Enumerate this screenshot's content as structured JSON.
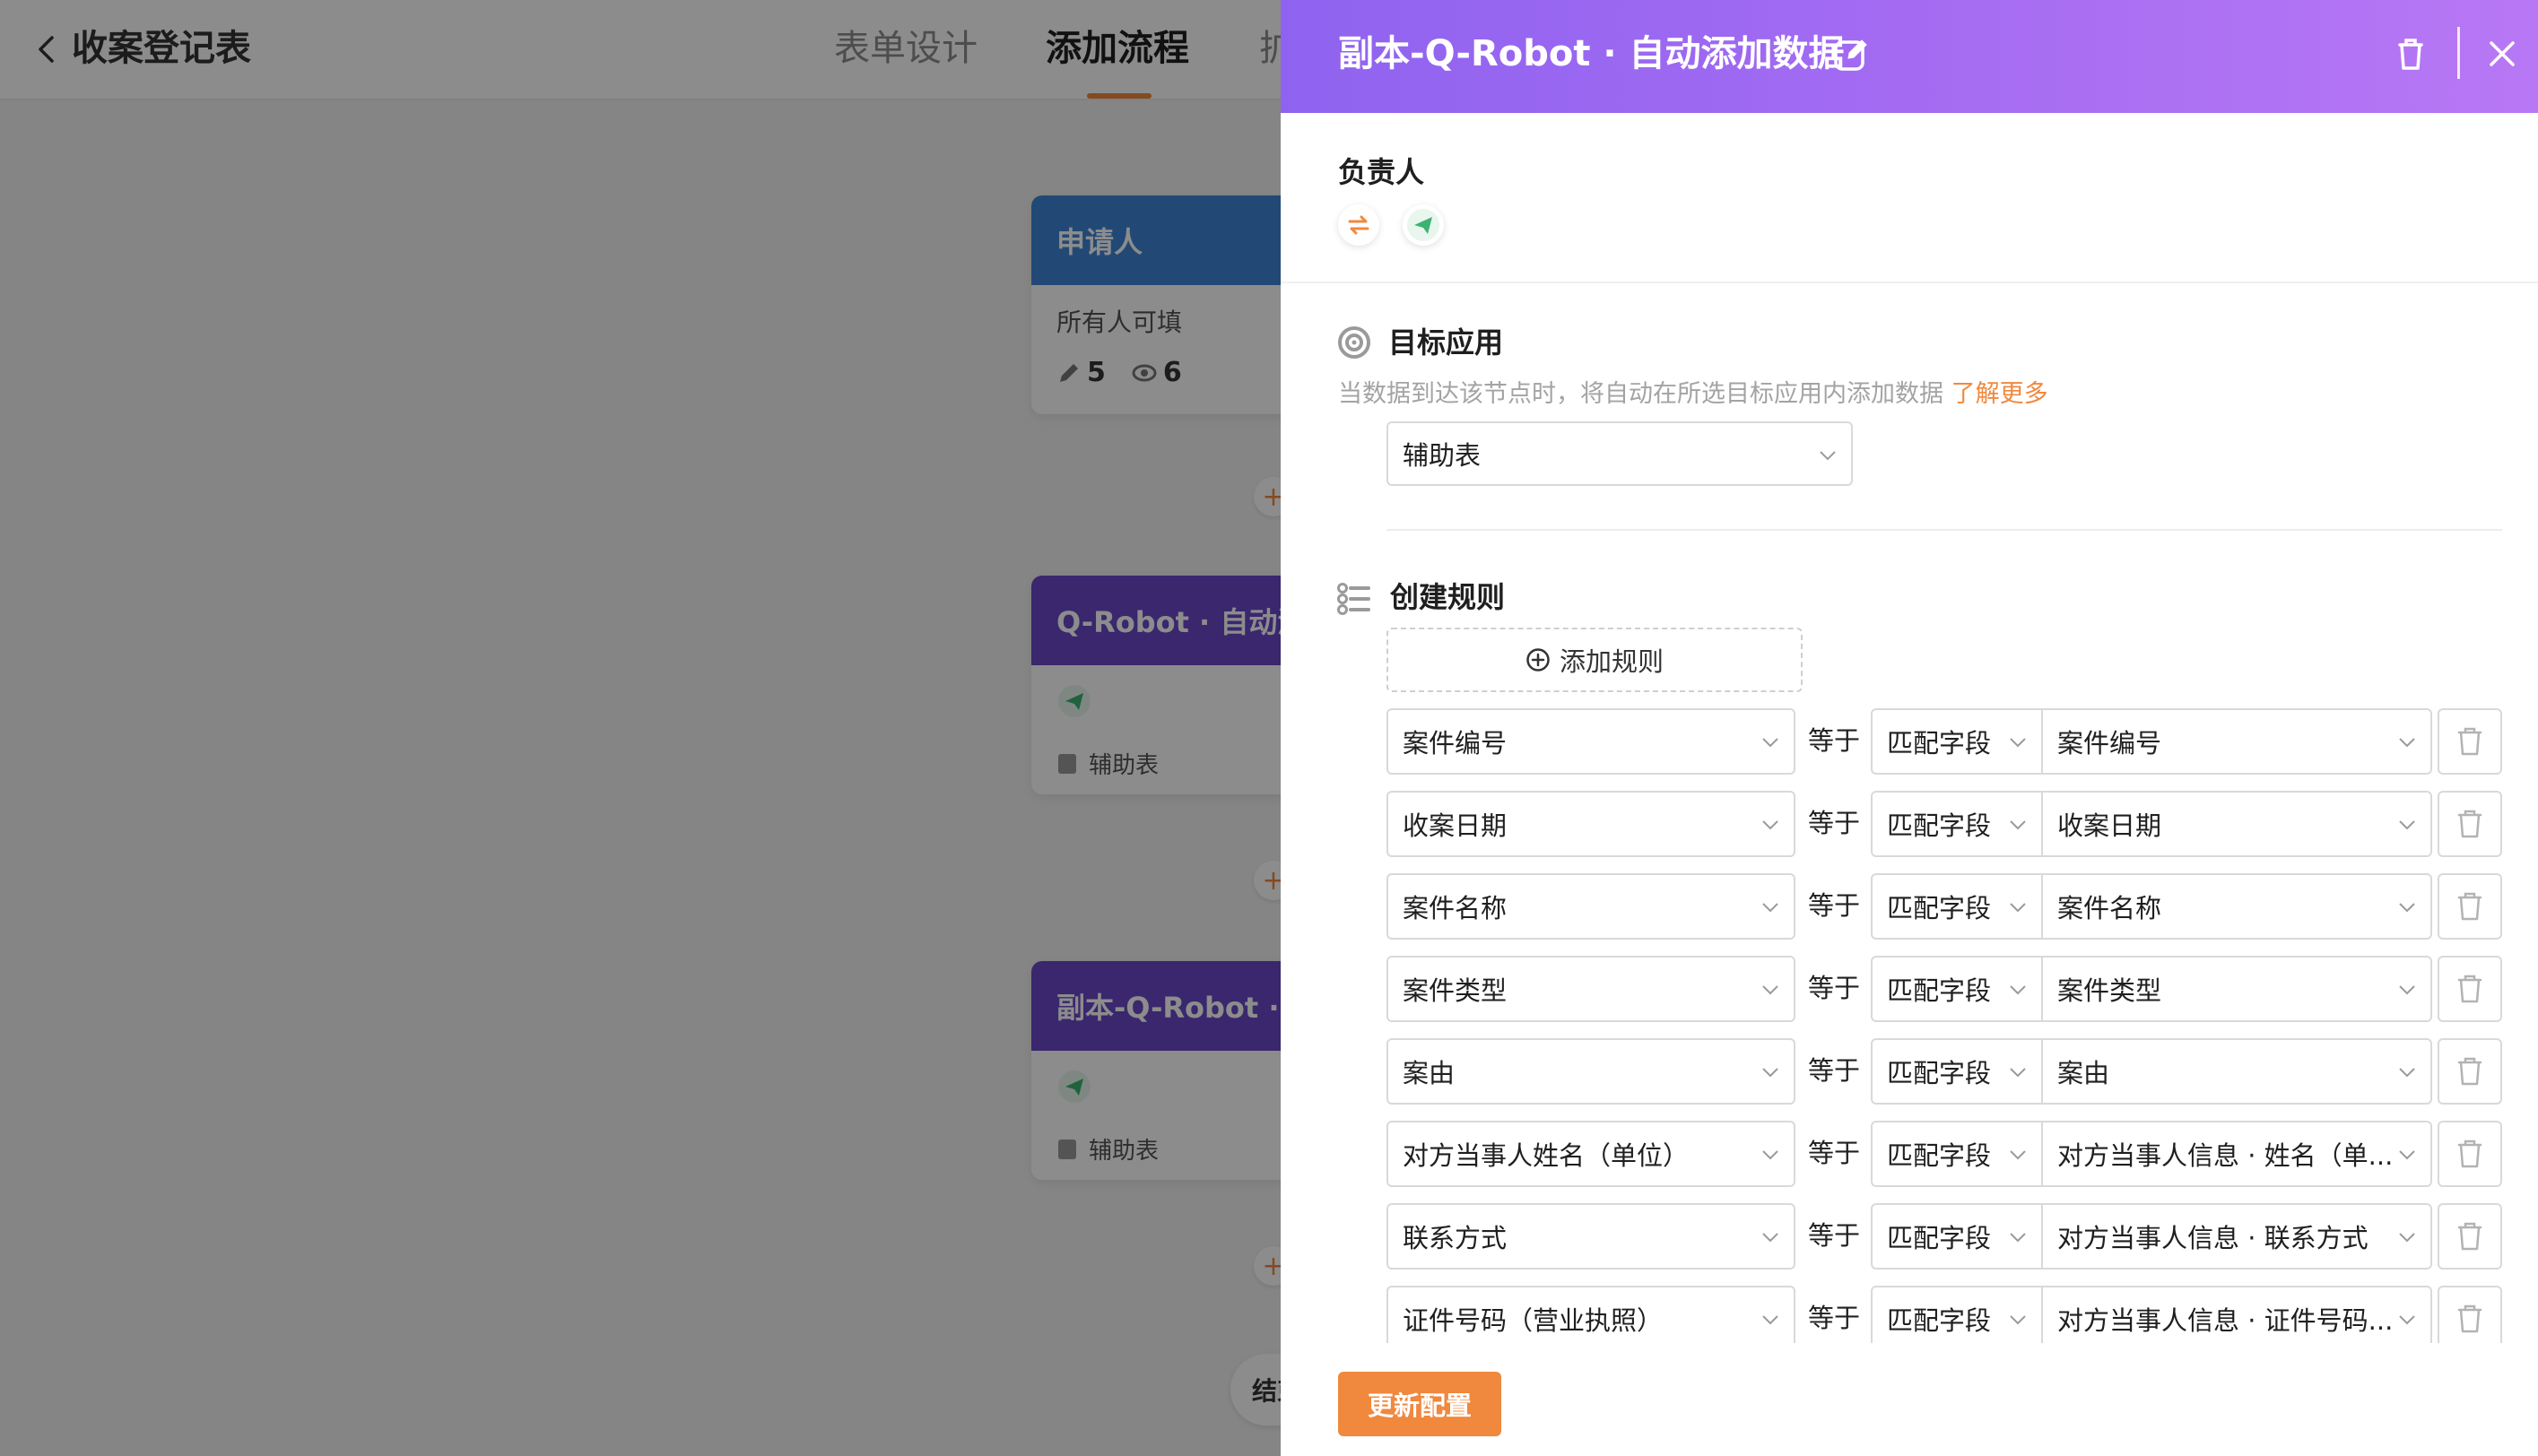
{
  "background": {
    "title": "收案登记表",
    "tabs": [
      {
        "label": "表单设计"
      },
      {
        "label": "添加流程"
      },
      {
        "label": "扩"
      }
    ],
    "nodes": [
      {
        "title": "申请人",
        "subtitle": "所有人可填",
        "edit_count": "5",
        "view_count": "6",
        "color": "#3f85d6"
      },
      {
        "title": "Q-Robot · 自动添",
        "target": "辅助表",
        "color": "#6a47c9"
      },
      {
        "title": "副本-Q-Robot · 自",
        "target": "辅助表",
        "color": "#6a47c9"
      }
    ],
    "end_label": "结束"
  },
  "drawer": {
    "title": "副本-Q-Robot · 自动添加数据",
    "owner": {
      "label": "负责人",
      "icons": [
        "swap-icon",
        "paper-plane-icon"
      ]
    },
    "target_app": {
      "title": "目标应用",
      "description": "当数据到达该节点时，将自动在所选目标应用内添加数据",
      "learn_more": "了解更多",
      "selected": "辅助表"
    },
    "rules": {
      "title": "创建规则",
      "add_label": "添加规则",
      "operator": "等于",
      "items": [
        {
          "field": "案件编号",
          "mode": "匹配字段",
          "value": "案件编号"
        },
        {
          "field": "收案日期",
          "mode": "匹配字段",
          "value": "收案日期"
        },
        {
          "field": "案件名称",
          "mode": "匹配字段",
          "value": "案件名称"
        },
        {
          "field": "案件类型",
          "mode": "匹配字段",
          "value": "案件类型"
        },
        {
          "field": "案由",
          "mode": "匹配字段",
          "value": "案由"
        },
        {
          "field": "对方当事人姓名（单位）",
          "mode": "匹配字段",
          "value": "对方当事人信息 · 姓名（单..."
        },
        {
          "field": "联系方式",
          "mode": "匹配字段",
          "value": "对方当事人信息 · 联系方式"
        },
        {
          "field": "证件号码（营业执照）",
          "mode": "匹配字段",
          "value": "对方当事人信息 · 证件号码..."
        }
      ]
    },
    "submit_label": "更新配置"
  },
  "colors": {
    "accent": "#f0883e",
    "header_gradient_start": "#8f63f0",
    "header_gradient_end": "#b878f5",
    "send_green": "#3cb371"
  }
}
